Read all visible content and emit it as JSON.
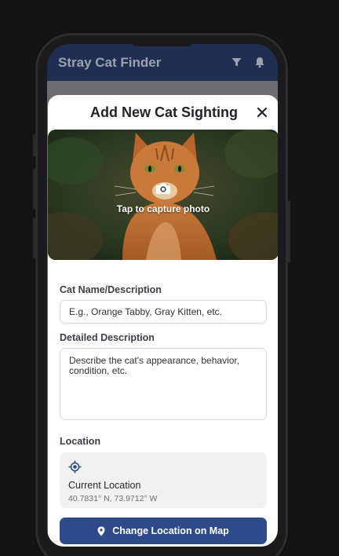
{
  "app": {
    "title": "Stray Cat Finder",
    "header_icons": [
      "filter-icon",
      "bell-icon"
    ]
  },
  "modal": {
    "title": "Add New Cat Sighting",
    "close_icon": "close-icon",
    "photo": {
      "label": "Tap to capture photo",
      "icon": "camera-icon",
      "subject": "orange tabby cat"
    },
    "fields": {
      "name_label": "Cat Name/Description",
      "name_placeholder": "E.g., Orange Tabby, Gray Kitten, etc.",
      "description_label": "Detailed Description",
      "description_placeholder": "Describe the cat's appearance, behavior, condition, etc."
    },
    "location": {
      "label": "Location",
      "icon": "location-target-icon",
      "name": "Current Location",
      "coords": "40.7831° N, 73.9712° W"
    },
    "map_button": {
      "label": "Change Location on Map",
      "icon": "map-pin-icon"
    }
  },
  "colors": {
    "header_bg": "#1f2e52",
    "accent": "#2f4a8a",
    "location_bg": "#f1f1f2"
  }
}
